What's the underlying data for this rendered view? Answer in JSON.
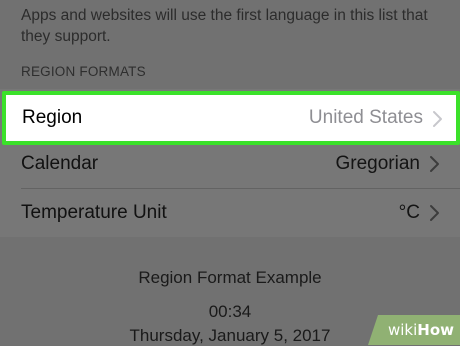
{
  "language_section": {
    "footer": "Apps and websites will use the first language in this list that they support."
  },
  "region_formats": {
    "header": "REGION FORMATS",
    "rows": [
      {
        "label": "Region",
        "value": "United States"
      },
      {
        "label": "Calendar",
        "value": "Gregorian"
      },
      {
        "label": "Temperature Unit",
        "value": "°C"
      }
    ]
  },
  "example": {
    "title": "Region Format Example",
    "time": "00:34",
    "date": "Thursday, January 5, 2017"
  },
  "watermark": {
    "text_wiki": "wiki",
    "text_how": "How"
  },
  "colors": {
    "highlight_border": "#3be12a",
    "dimmed_background": "#717171",
    "secondary_value": "#8e8e93"
  },
  "icons": [
    "chevron-right-icon"
  ]
}
